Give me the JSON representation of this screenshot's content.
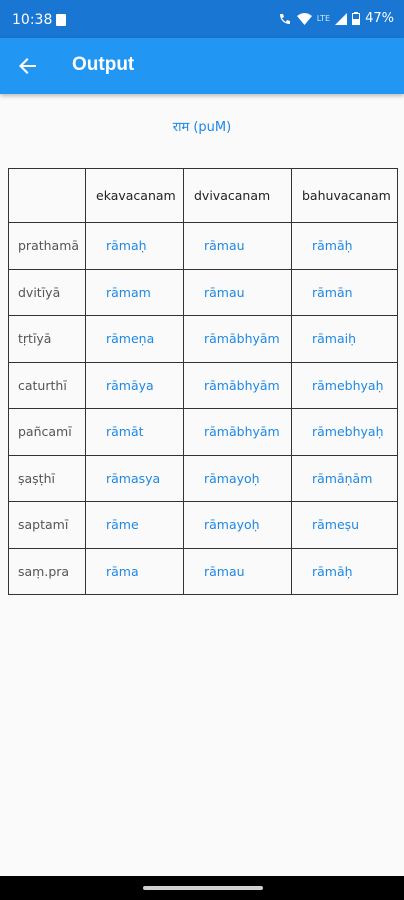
{
  "status_bar": {
    "time": "10:38",
    "network": "LTE",
    "battery": "47%"
  },
  "app_bar": {
    "title": "Output",
    "back_icon": "arrow-back-icon"
  },
  "subtitle": "राम (puM)",
  "table": {
    "headers": [
      "",
      "ekavacanam",
      "dvivacanam",
      "bahuvacanam"
    ],
    "rows": [
      {
        "case": "prathamā",
        "forms": [
          "rāmaḥ",
          "rāmau",
          "rāmāḥ"
        ]
      },
      {
        "case": "dvitīyā",
        "forms": [
          "rāmam",
          "rāmau",
          "rāmān"
        ]
      },
      {
        "case": "tṛtīyā",
        "forms": [
          "rāmeṇa",
          "rāmābhyām",
          "rāmaiḥ"
        ]
      },
      {
        "case": "caturthī",
        "forms": [
          "rāmāya",
          "rāmābhyām",
          "rāmebhyaḥ"
        ]
      },
      {
        "case": "pañcamī",
        "forms": [
          "rāmāt",
          "rāmābhyām",
          "rāmebhyaḥ"
        ]
      },
      {
        "case": "ṣaṣṭhī",
        "forms": [
          "rāmasya",
          "rāmayoḥ",
          "rāmāṇām"
        ]
      },
      {
        "case": "saptamī",
        "forms": [
          "rāme",
          "rāmayoḥ",
          "rāmeṣu"
        ]
      },
      {
        "case": "saṃ.pra",
        "forms": [
          "rāma",
          "rāmau",
          "rāmāḥ"
        ]
      }
    ]
  },
  "colors": {
    "app_bar": "#2196f3",
    "status_bar": "#1976d2",
    "link_text": "#1e88e5"
  }
}
